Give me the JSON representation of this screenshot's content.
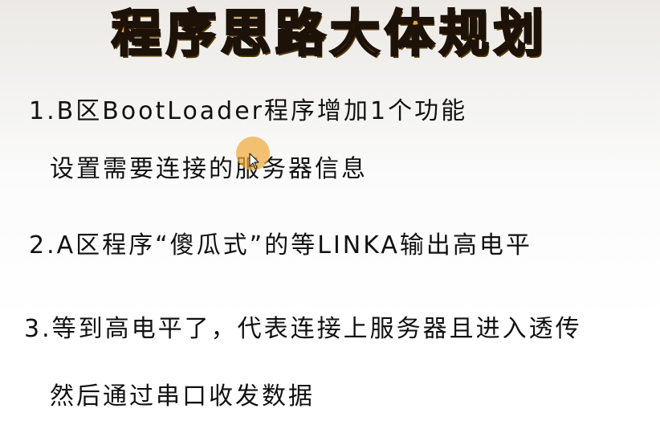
{
  "slide": {
    "title": "程序思路大体规划",
    "items": [
      {
        "line1": "1.B区BootLoader程序增加1个功能",
        "line2": "设置需要连接的服务器信息"
      },
      {
        "line1": "2.A区程序“傻瓜式”的等LINKA输出高电平"
      },
      {
        "line1": "3.等到高电平了，代表连接上服务器且进入透传",
        "line2": "然后通过串口收发数据"
      }
    ]
  },
  "colors": {
    "title_fill": "#f0a51c",
    "title_outline": "#1d1208",
    "pointer_highlight": "#f0aa3c"
  },
  "icons": {
    "cursor": "mouse-pointer-icon"
  }
}
